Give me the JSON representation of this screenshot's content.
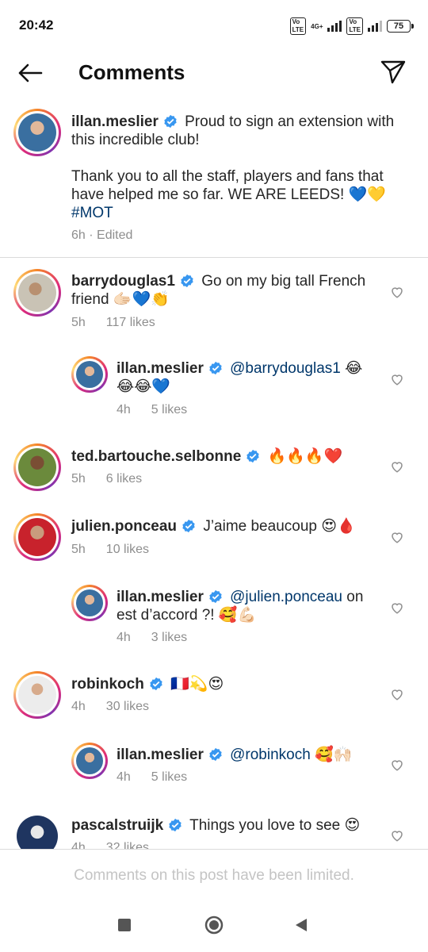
{
  "status_bar": {
    "time": "20:42",
    "network": "4G+",
    "battery": "75"
  },
  "header": {
    "title": "Comments",
    "back_icon": "arrow-left-icon",
    "share_icon": "paper-plane-icon"
  },
  "caption": {
    "username": "illan.meslier",
    "text_1": "Proud to sign an extension with this incredible club!",
    "text_2": "Thank you to all the staff, players and fans that have helped me so far. WE ARE LEEDS! 💙💛",
    "hashtag": "#MOT",
    "meta": "6h · Edited"
  },
  "comments": [
    {
      "username": "barrydouglas1",
      "text": "Go on my big tall French friend 🫱🏻💙👏",
      "time": "5h",
      "likes": "117 likes"
    },
    {
      "username": "illan.meslier",
      "mention": "@barrydouglas1",
      "text": "😂😂😂💙",
      "time": "4h",
      "likes": "5 likes"
    },
    {
      "username": "ted.bartouche.selbonne",
      "text": "🔥🔥🔥❤️",
      "time": "5h",
      "likes": "6 likes"
    },
    {
      "username": "julien.ponceau",
      "text": "J’aime beaucoup 😍🩸",
      "time": "5h",
      "likes": "10 likes"
    },
    {
      "username": "illan.meslier",
      "mention": "@julien.ponceau",
      "text": "on est d’accord ?! 🥰💪🏻",
      "time": "4h",
      "likes": "3 likes"
    },
    {
      "username": "robinkoch",
      "text": "🇫🇷💫😍",
      "time": "4h",
      "likes": "30 likes"
    },
    {
      "username": "illan.meslier",
      "mention": "@robinkoch",
      "text": "🥰🙌🏻",
      "time": "4h",
      "likes": "5 likes"
    },
    {
      "username": "pascalstruijk",
      "text": "Things you love to see 😍",
      "time": "4h",
      "likes": "32 likes"
    }
  ],
  "footer": {
    "limited_text": "Comments on this post have been limited."
  }
}
